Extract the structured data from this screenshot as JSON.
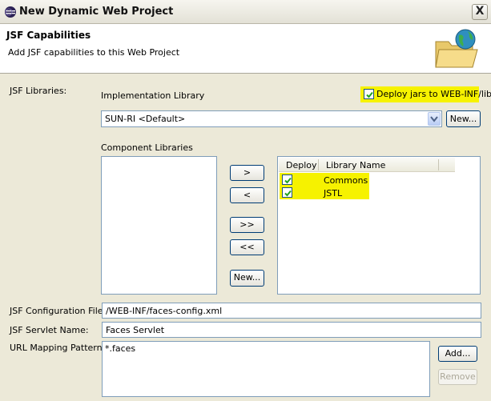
{
  "window": {
    "title": "New Dynamic Web Project",
    "close_label": "X"
  },
  "banner": {
    "title": "JSF Capabilities",
    "description": "Add JSF capabilities to this Web Project"
  },
  "libraries": {
    "label": "JSF Libraries:",
    "implementation_label": "Implementation Library",
    "deploy_jars_label": "Deploy jars to WEB-INF/lib",
    "deploy_jars_checked": true,
    "implementation_value": "SUN-RI <Default>",
    "new_impl_button": "New...",
    "component_label": "Component Libraries",
    "add_button": ">",
    "remove_button": "<",
    "add_all_button": ">>",
    "remove_all_button": "<<",
    "new_component_button": "New...",
    "table_headers": [
      "Deploy",
      "Library Name"
    ],
    "selected_libraries": [
      {
        "name": "Commons",
        "deploy": true
      },
      {
        "name": "JSTL",
        "deploy": true
      }
    ]
  },
  "config": {
    "file_label": "JSF Configuration File:",
    "file_value": "/WEB-INF/faces-config.xml",
    "servlet_label": "JSF Servlet Name:",
    "servlet_value": "Faces Servlet",
    "mapping_label": "URL Mapping Patterns:",
    "mapping_values": [
      "*.faces"
    ],
    "add_button": "Add...",
    "remove_button": "Remove"
  },
  "colors": {
    "highlight": "#f6f200",
    "check": "#21a121"
  }
}
